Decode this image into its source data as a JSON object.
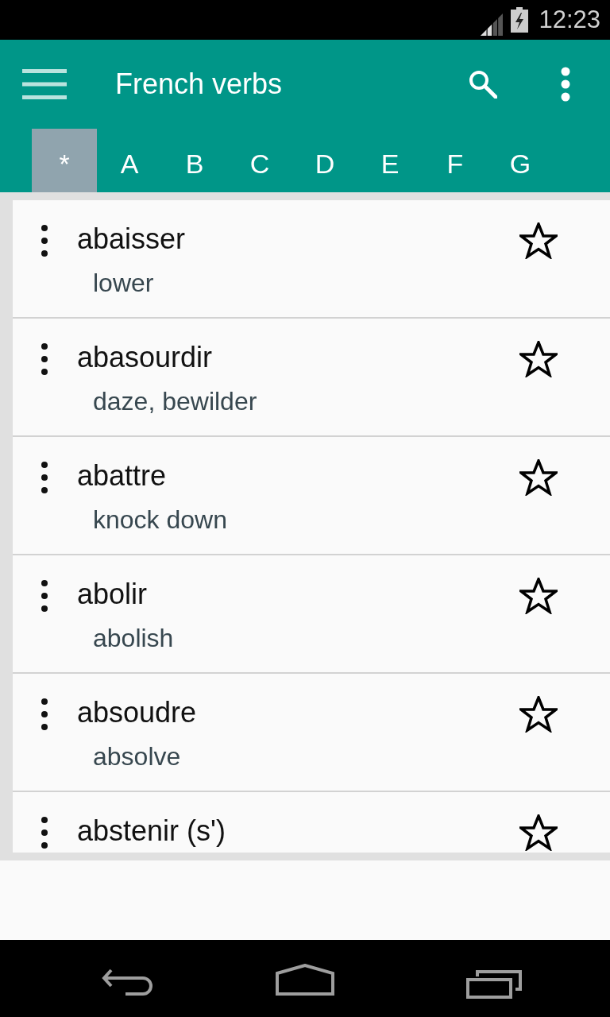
{
  "status_bar": {
    "time": "12:23"
  },
  "app_bar": {
    "title": "French verbs"
  },
  "letter_tabs": [
    {
      "label": "*",
      "selected": true
    },
    {
      "label": "A",
      "selected": false
    },
    {
      "label": "B",
      "selected": false
    },
    {
      "label": "C",
      "selected": false
    },
    {
      "label": "D",
      "selected": false
    },
    {
      "label": "E",
      "selected": false
    },
    {
      "label": "F",
      "selected": false
    },
    {
      "label": "G",
      "selected": false
    }
  ],
  "verbs": [
    {
      "verb": "abaisser",
      "translation": "lower",
      "starred": false
    },
    {
      "verb": "abasourdir",
      "translation": "daze, bewilder",
      "starred": false
    },
    {
      "verb": "abattre",
      "translation": "knock down",
      "starred": false
    },
    {
      "verb": "abolir",
      "translation": "abolish",
      "starred": false
    },
    {
      "verb": "absoudre",
      "translation": "absolve",
      "starred": false
    },
    {
      "verb": "abstenir (s')",
      "starred": false
    }
  ]
}
